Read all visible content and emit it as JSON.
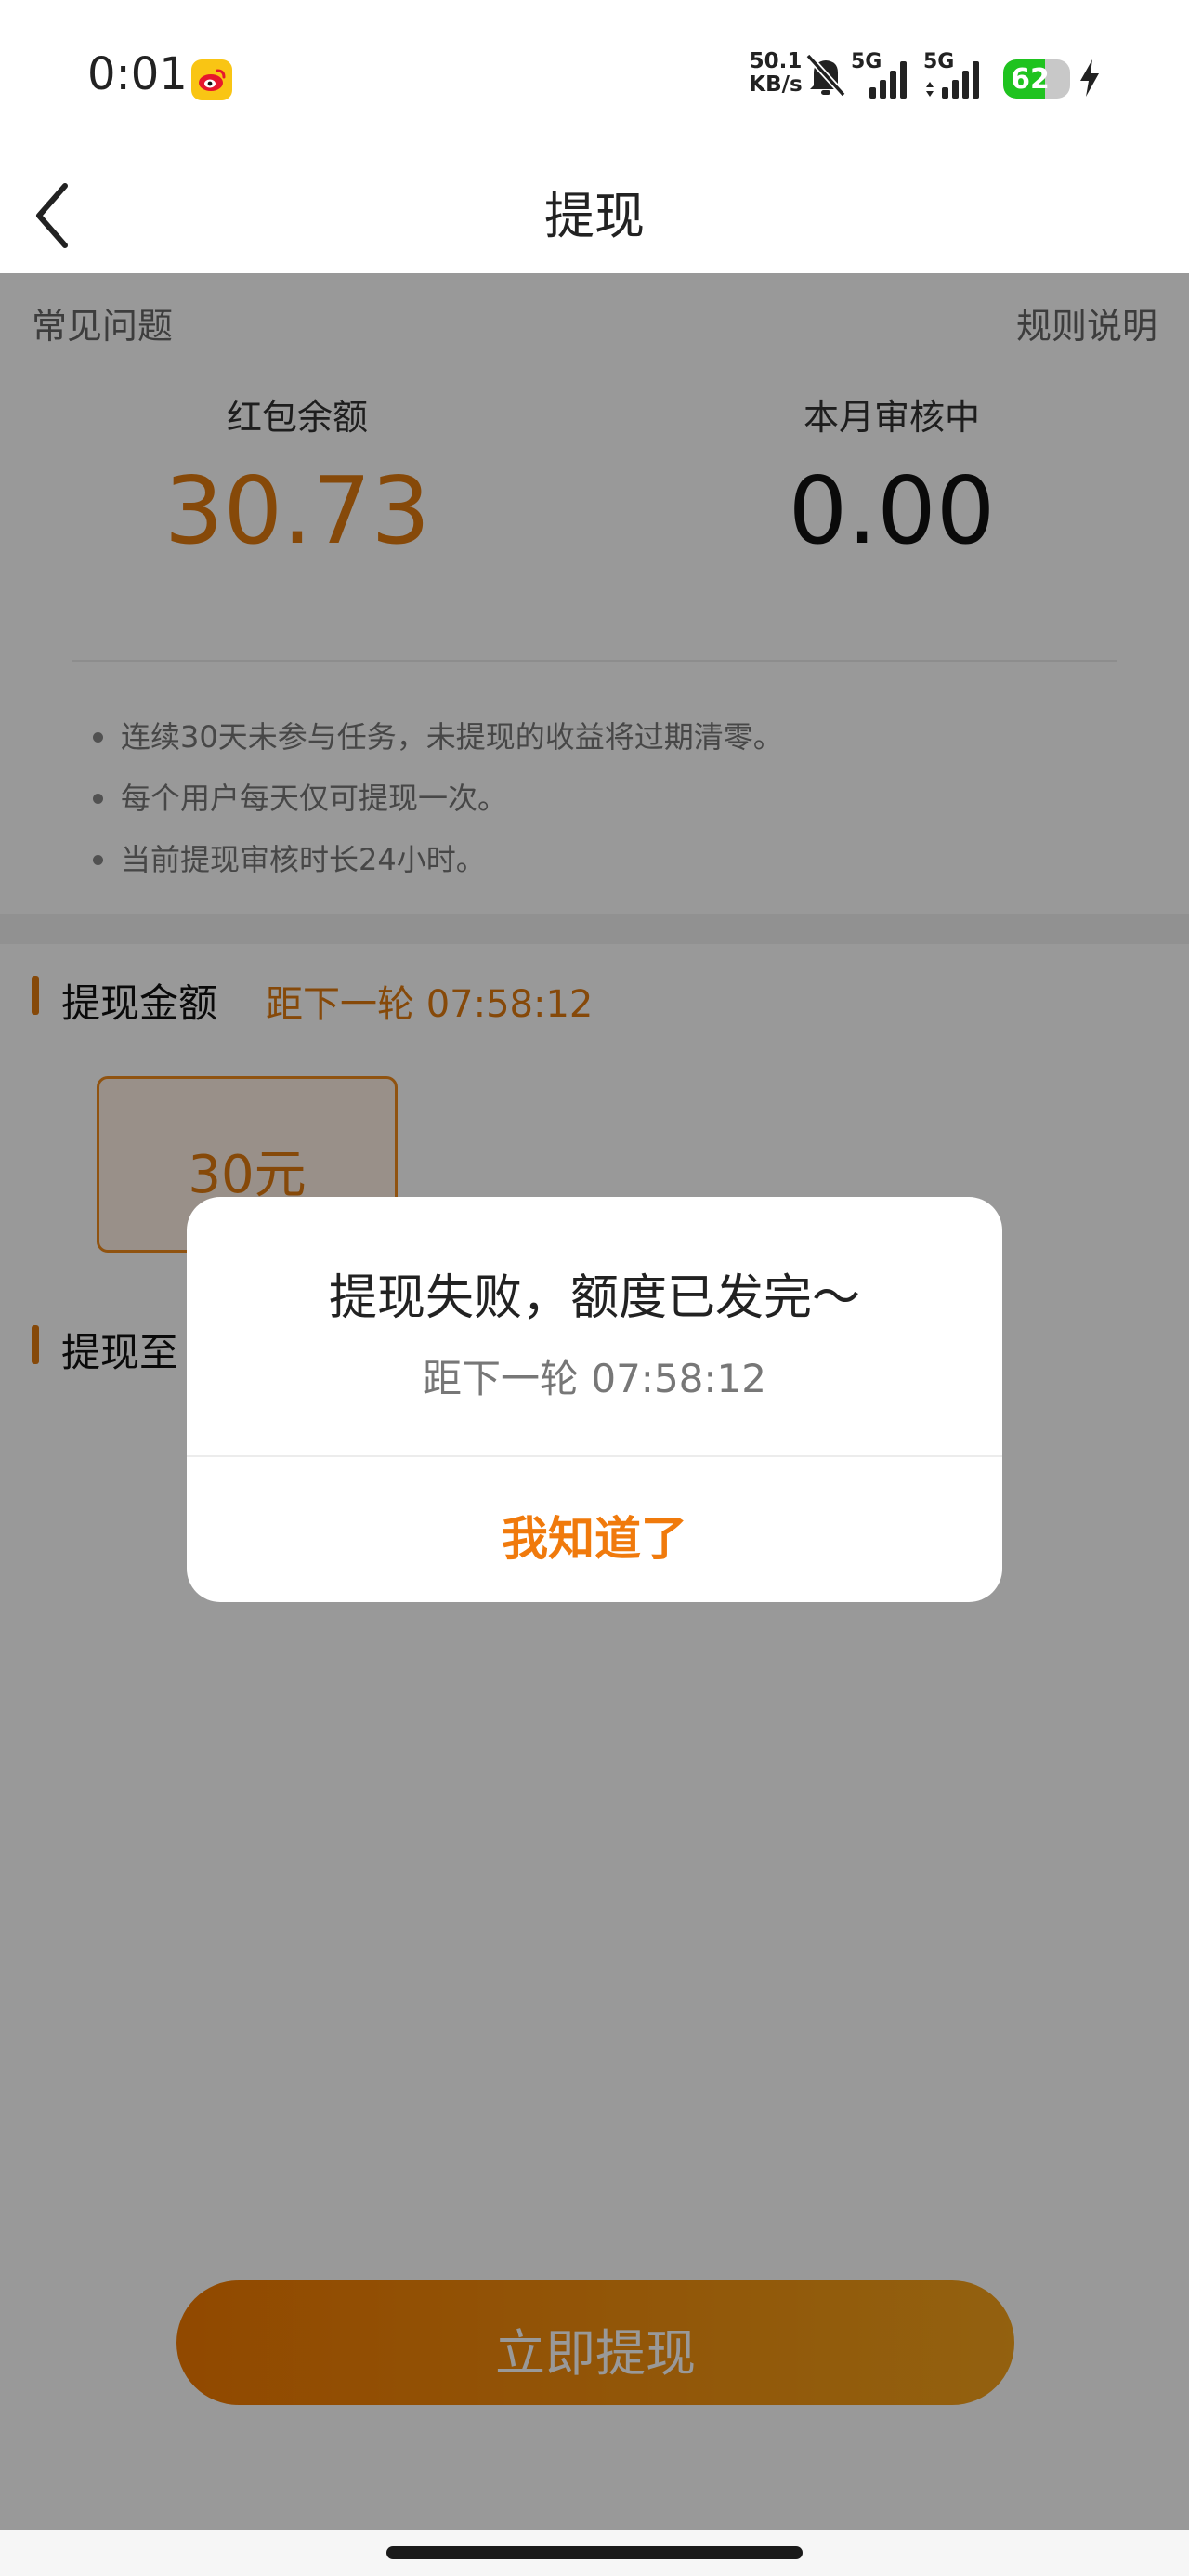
{
  "status_bar": {
    "time": "0:01",
    "net_speed_value": "50.1",
    "net_speed_unit": "KB/s",
    "signal_1_label": "5G",
    "signal_2_label": "5G",
    "battery_level": "62",
    "battery_fraction": 0.62,
    "app_icon": "weibo-icon",
    "icons": [
      "bell-off-icon",
      "signal-icon",
      "charging-bolt-icon"
    ]
  },
  "nav": {
    "title": "提现",
    "back_icon": "chevron-left-icon"
  },
  "header_links": {
    "faq": "常见问题",
    "rules": "规则说明"
  },
  "stats": {
    "balance_label": "红包余额",
    "balance_value": "30.73",
    "review_label": "本月审核中",
    "review_value": "0.00"
  },
  "notes": [
    "连续30天未参与任务，未提现的收益将过期清零。",
    "每个用户每天仅可提现一次。",
    "当前提现审核时长24小时。"
  ],
  "amount_section": {
    "title": "提现金额",
    "countdown": "距下一轮 07:58:12",
    "options": [
      "30元"
    ]
  },
  "destination_section": {
    "title": "提现至"
  },
  "cta": {
    "label": "立即提现"
  },
  "dialog": {
    "title": "提现失败，额度已发完～",
    "subtitle": "距下一轮 07:58:12",
    "button": "我知道了"
  },
  "colors": {
    "accent": "#f07a0c",
    "overlay": "rgba(0,0,0,0.40)"
  }
}
